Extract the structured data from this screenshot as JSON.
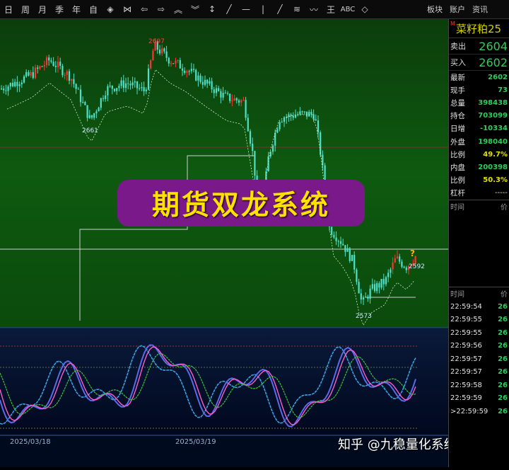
{
  "toolbar": {
    "items": [
      {
        "name": "day-period-button",
        "label": "日"
      },
      {
        "name": "week-period-button",
        "label": "周"
      },
      {
        "name": "month-period-button",
        "label": "月"
      },
      {
        "name": "season-period-button",
        "label": "季"
      },
      {
        "name": "year-period-button",
        "label": "年"
      },
      {
        "name": "custom-period-button",
        "label": "自"
      },
      {
        "name": "zoom-in-icon",
        "label": "◈"
      },
      {
        "name": "zoom-out-icon",
        "label": "⋈"
      },
      {
        "name": "arrow-left-icon",
        "label": "⇦"
      },
      {
        "name": "arrow-right-icon",
        "label": "⇨"
      },
      {
        "name": "chevron-up-icon",
        "label": "︽"
      },
      {
        "name": "chevron-down-icon",
        "label": "︾"
      },
      {
        "name": "crosshair-icon",
        "label": "↕"
      },
      {
        "name": "line-tool-icon",
        "label": "╱"
      },
      {
        "name": "hline-tool-icon",
        "label": "—"
      },
      {
        "name": "vline-tool-icon",
        "label": "|"
      },
      {
        "name": "ray-tool-icon",
        "label": "╱"
      },
      {
        "name": "channel-tool-icon",
        "label": "≋"
      },
      {
        "name": "wave-tool-icon",
        "label": "〰"
      },
      {
        "name": "fib-tool-icon",
        "label": "王"
      },
      {
        "name": "text-tool-icon",
        "label": "ABC"
      },
      {
        "name": "eraser-icon",
        "label": "◇"
      }
    ],
    "right": [
      "板块",
      "账户",
      "资讯"
    ]
  },
  "symbol": {
    "name": "菜籽粕25",
    "marker": "M"
  },
  "quote": {
    "sell_label": "卖出",
    "sell_value": "2604",
    "buy_label": "买入",
    "buy_value": "2602"
  },
  "stats": [
    {
      "label": "最新",
      "value": "2602",
      "cls": ""
    },
    {
      "label": "现手",
      "value": "73",
      "cls": ""
    },
    {
      "label": "总量",
      "value": "398438",
      "cls": ""
    },
    {
      "label": "持仓",
      "value": "703099",
      "cls": ""
    },
    {
      "label": "日增",
      "value": "-10334",
      "cls": ""
    },
    {
      "label": "外盘",
      "value": "198040",
      "cls": ""
    },
    {
      "label": "比例",
      "value": "49.7%",
      "cls": "y"
    },
    {
      "label": "内盘",
      "value": "200398",
      "cls": ""
    },
    {
      "label": "比例",
      "value": "50.3%",
      "cls": "y"
    },
    {
      "label": "杠杆",
      "value": "-----",
      "cls": "w"
    }
  ],
  "table1_header": {
    "time": "时间",
    "price": "价"
  },
  "table2_header": {
    "time": "时间",
    "price": "价"
  },
  "ticks": [
    {
      "time": "22:59:54",
      "price": "26"
    },
    {
      "time": "22:59:55",
      "price": "26"
    },
    {
      "time": "22:59:55",
      "price": "26"
    },
    {
      "time": "22:59:56",
      "price": "26"
    },
    {
      "time": "22:59:57",
      "price": "26"
    },
    {
      "time": "22:59:57",
      "price": "26"
    },
    {
      "time": "22:59:58",
      "price": "26"
    },
    {
      "time": "22:59:59",
      "price": "26"
    },
    {
      "time": ">22:59:59",
      "price": "26"
    }
  ],
  "banner": "期货双龙系统",
  "watermark": "知乎 @九稳量化系统网",
  "chart_data": {
    "type": "candlestick",
    "price_labels": [
      {
        "text": "2697",
        "value": 2697
      },
      {
        "text": "2661",
        "value": 2661
      },
      {
        "text": "2592",
        "value": 2592
      },
      {
        "text": "2573",
        "value": 2573
      }
    ],
    "marker_text": "?",
    "date_labels": [
      "2025/03/18",
      "2025/03/19"
    ],
    "oscillator": {
      "type": "line",
      "series_count": 3
    }
  },
  "colors": {
    "panel_bg": "#0a4a0a",
    "osc_bg": "#000c28",
    "up": "#ff3333",
    "down": "#4fe0c8",
    "accent": "#ffe000"
  }
}
